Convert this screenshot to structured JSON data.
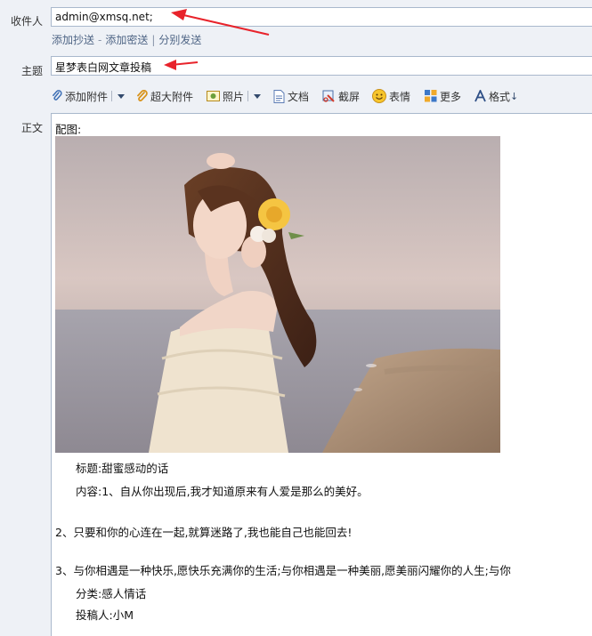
{
  "compose": {
    "to_label": "收件人",
    "to_value": "admin@xmsq.net;",
    "links": {
      "add_cc": "添加抄送",
      "add_bcc": "添加密送",
      "separate_send": "分别发送"
    },
    "subject_label": "主题",
    "subject_value": "星梦表白网文章投稿",
    "body_label": "正文"
  },
  "toolbar": {
    "attach": "添加附件",
    "large_attach": "超大附件",
    "photo": "照片",
    "document": "文档",
    "screenshot": "截屏",
    "emoji": "表情",
    "more": "更多",
    "format": "格式"
  },
  "body": {
    "image_caption": "配图:",
    "title": "标题:甜蜜感动的话",
    "content_intro": "内容:1、自从你出现后,我才知道原来有人爱是那么的美好。",
    "line2": "2、只要和你的心连在一起,就算迷路了,我也能自己也能回去!",
    "line3": "3、与你相遇是一种快乐,愿快乐充满你的生活;与你相遇是一种美丽,愿美丽闪耀你的人生;与你",
    "category": "分类:感人情话",
    "author": "投稿人:小M"
  },
  "colors": {
    "background": "#eef1f6",
    "border": "#a9b8cc",
    "link": "#4f6585",
    "arrow": "#e8232b"
  },
  "icons": [
    "paperclip-icon",
    "large-attachment-icon",
    "photo-icon",
    "document-icon",
    "screenshot-icon",
    "emoji-icon",
    "more-icon",
    "format-icon"
  ]
}
